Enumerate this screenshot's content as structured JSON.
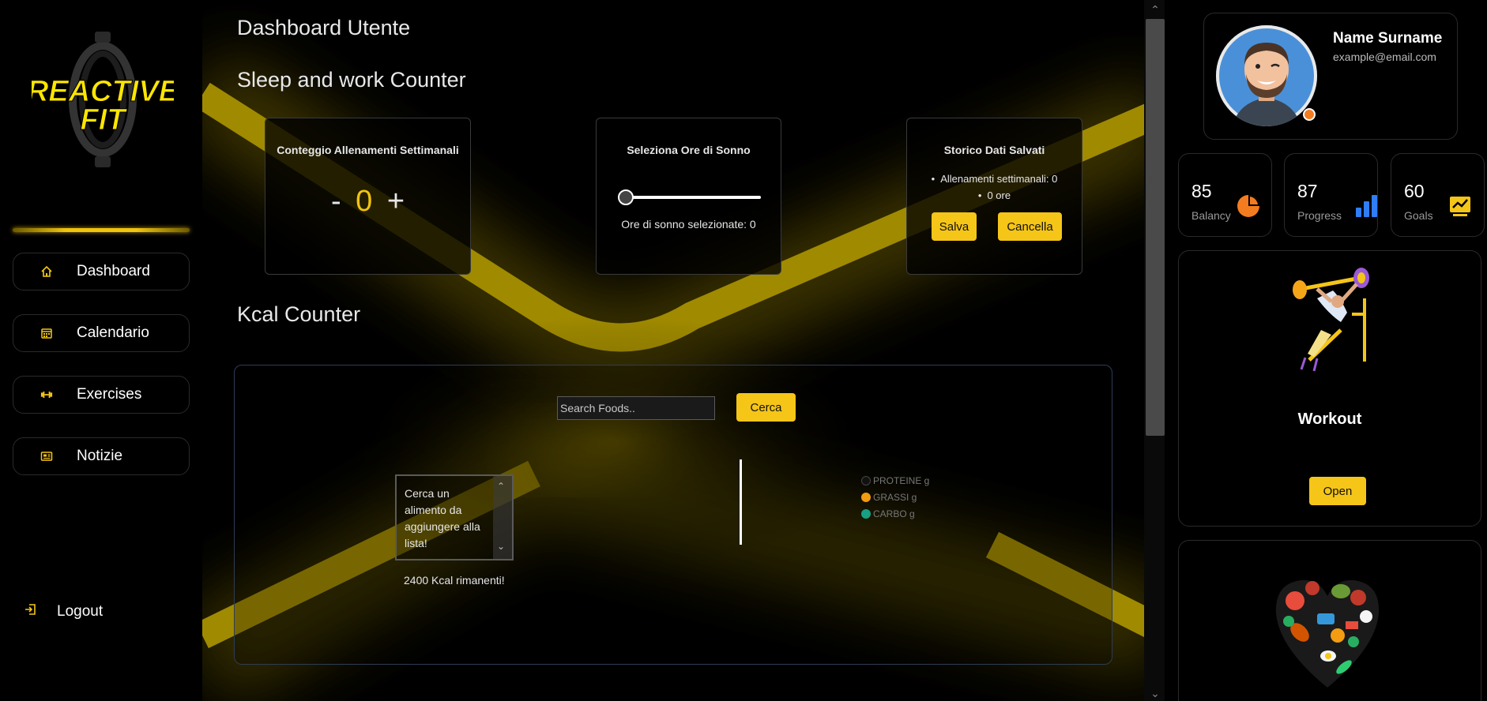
{
  "app": {
    "logo_text_1": "REACTIVE",
    "logo_text_2": "FIT",
    "accent": "#f5c518"
  },
  "sidebar": {
    "items": [
      {
        "label": "Dashboard",
        "icon": "home-icon"
      },
      {
        "label": "Calendario",
        "icon": "calendar-icon"
      },
      {
        "label": "Exercises",
        "icon": "dumbbell-icon"
      },
      {
        "label": "Notizie",
        "icon": "newspaper-icon"
      }
    ],
    "logout_label": "Logout"
  },
  "main": {
    "title": "Dashboard Utente",
    "sleep_section_title": "Sleep and work Counter",
    "workout_card": {
      "title": "Conteggio Allenamenti Settimanali",
      "minus": "-",
      "value": "0",
      "plus": "+"
    },
    "sleep_card": {
      "title": "Seleziona Ore di Sonno",
      "slider_value": 0,
      "caption": "Ore di sonno selezionate: 0"
    },
    "history_card": {
      "title": "Storico Dati Salvati",
      "items": [
        "Allenamenti settimanali: 0",
        "0 ore"
      ],
      "save_label": "Salva",
      "delete_label": "Cancella"
    },
    "kcal_section_title": "Kcal Counter",
    "kcal": {
      "search_placeholder": "Search Foods..",
      "search_button": "Cerca",
      "list_placeholder": "Cerca un alimento da aggiungere alla lista!",
      "remaining": "2400 Kcal rimanenti!",
      "legend": [
        {
          "label": "PROTEINE g",
          "color": "#111111"
        },
        {
          "label": "GRASSI g",
          "color": "#f39c12"
        },
        {
          "label": "CARBO g",
          "color": "#16a085"
        }
      ]
    }
  },
  "profile": {
    "name": "Name Surname",
    "email": "example@email.com"
  },
  "stats": [
    {
      "value": "85",
      "label": "Balancy",
      "icon": "pie-chart-icon",
      "color": "#f47c20"
    },
    {
      "value": "87",
      "label": "Progress",
      "icon": "bar-chart-icon",
      "color": "#2f7ef5"
    },
    {
      "value": "60",
      "label": "Goals",
      "icon": "trend-chart-icon",
      "color": "#f5c518"
    }
  ],
  "workout_panel": {
    "title": "Workout",
    "open_label": "Open"
  }
}
